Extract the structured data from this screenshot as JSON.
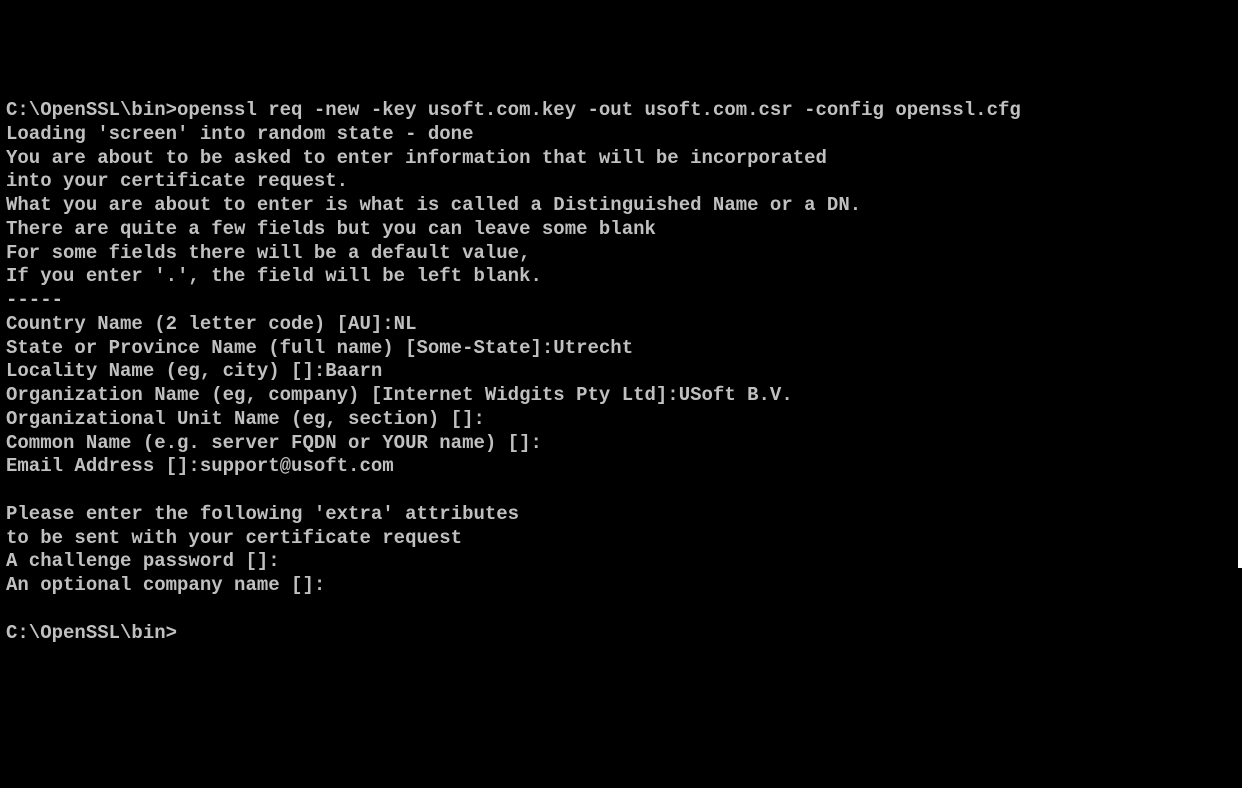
{
  "lines": [
    {
      "prompt": "C:\\OpenSSL\\bin>",
      "command": "openssl req -new -key usoft.com.key -out usoft.com.csr -config openssl.cfg"
    },
    {
      "text": "Loading 'screen' into random state - done"
    },
    {
      "text": "You are about to be asked to enter information that will be incorporated"
    },
    {
      "text": "into your certificate request."
    },
    {
      "text": "What you are about to enter is what is called a Distinguished Name or a DN."
    },
    {
      "text": "There are quite a few fields but you can leave some blank"
    },
    {
      "text": "For some fields there will be a default value,"
    },
    {
      "text": "If you enter '.', the field will be left blank."
    },
    {
      "text": "-----"
    },
    {
      "text": "Country Name (2 letter code) [AU]:NL"
    },
    {
      "text": "State or Province Name (full name) [Some-State]:Utrecht"
    },
    {
      "text": "Locality Name (eg, city) []:Baarn"
    },
    {
      "text": "Organization Name (eg, company) [Internet Widgits Pty Ltd]:USoft B.V."
    },
    {
      "text": "Organizational Unit Name (eg, section) []:"
    },
    {
      "text": "Common Name (e.g. server FQDN or YOUR name) []:"
    },
    {
      "text": "Email Address []:support@usoft.com"
    },
    {
      "text": ""
    },
    {
      "text": "Please enter the following 'extra' attributes"
    },
    {
      "text": "to be sent with your certificate request"
    },
    {
      "text": "A challenge password []:"
    },
    {
      "text": "An optional company name []:"
    },
    {
      "text": ""
    },
    {
      "prompt": "C:\\OpenSSL\\bin>",
      "command": ""
    }
  ]
}
